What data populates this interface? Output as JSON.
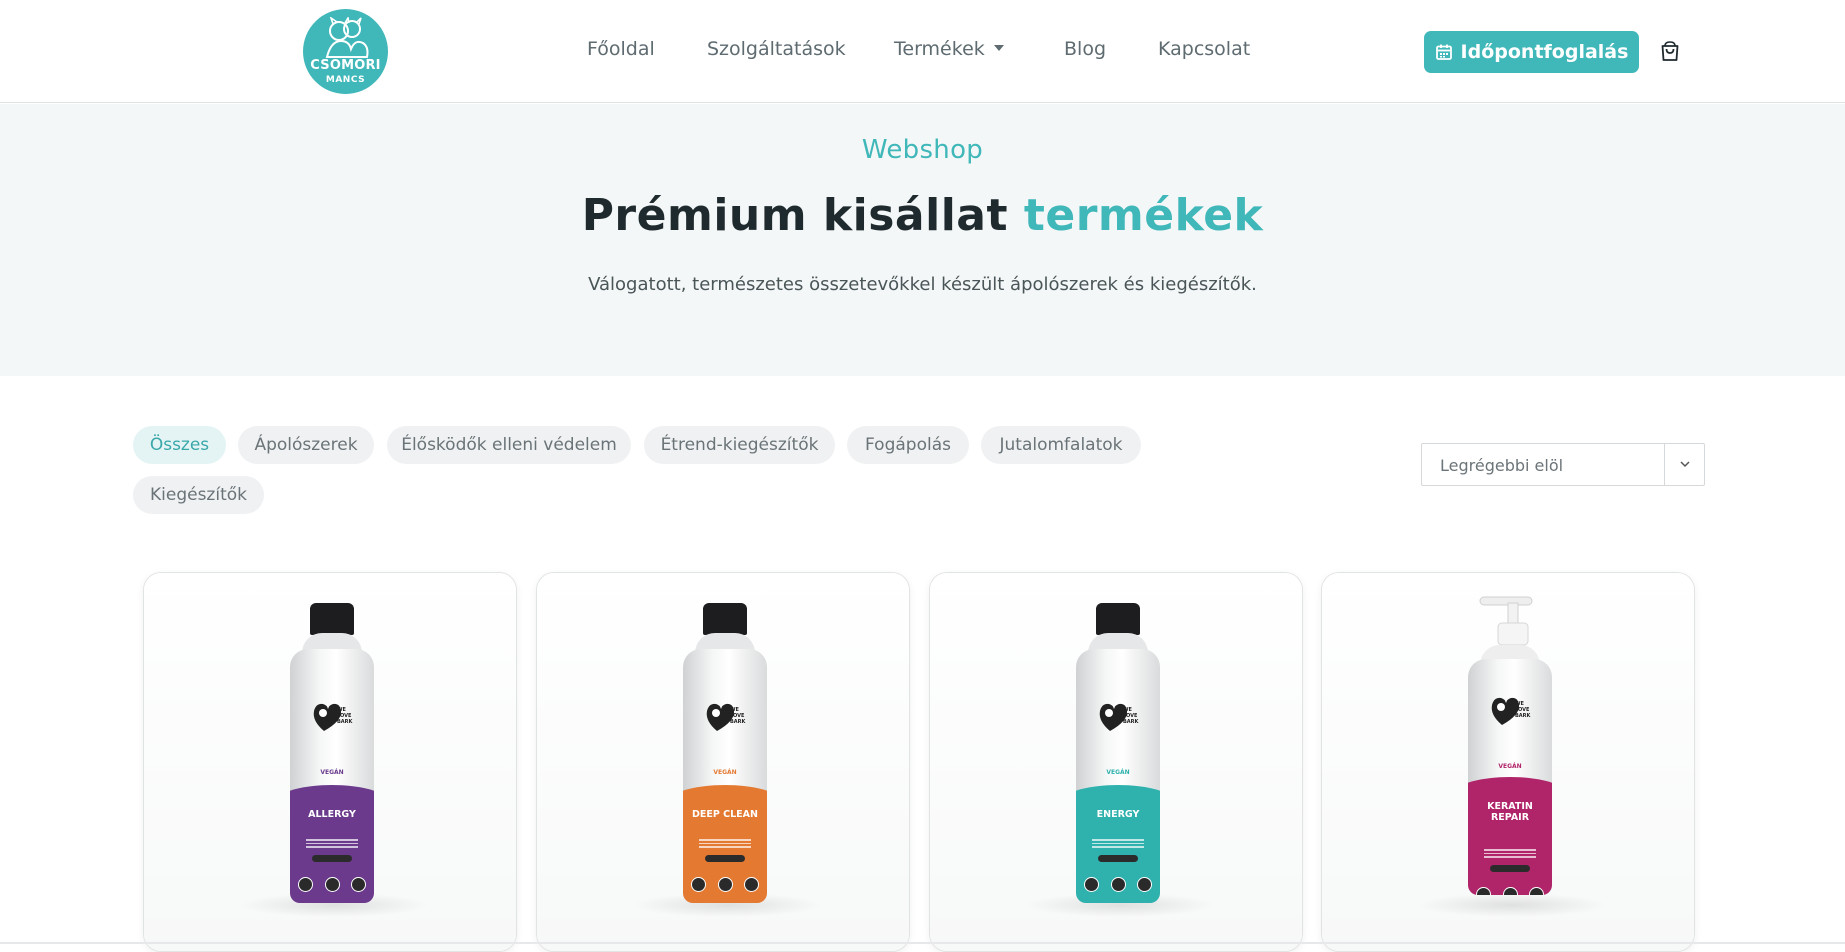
{
  "header": {
    "logo": {
      "name": "CSÖMÖRI",
      "sub": "MANCS"
    },
    "nav": [
      {
        "label": "Főoldal"
      },
      {
        "label": "Szolgáltatások"
      },
      {
        "label": "Termékek"
      },
      {
        "label": "Blog"
      },
      {
        "label": "Kapcsolat"
      }
    ],
    "book_button": "Időpontfoglalás"
  },
  "hero": {
    "kicker": "Webshop",
    "title_main": "Prémium kisállat",
    "title_accent": "termékek",
    "subtitle": "Válogatott, természetes összetevőkkel készült ápolószerek és kiegészítők."
  },
  "filters": [
    {
      "label": "Összes",
      "active": true
    },
    {
      "label": "Ápolószerek",
      "active": false
    },
    {
      "label": "Élősködők elleni védelem",
      "active": false
    },
    {
      "label": "Étrend-kiegészítők",
      "active": false
    },
    {
      "label": "Fogápolás",
      "active": false
    },
    {
      "label": "Jutalomfalatok",
      "active": false
    },
    {
      "label": "Kiegészítők",
      "active": false
    }
  ],
  "sort": {
    "value": "Legrégebbi elöl"
  },
  "products": [
    {
      "name_line1": "ALLERGY",
      "name_line2": "",
      "color": "#6b3a8c",
      "accent": "#6b3a8c",
      "type": "bottle"
    },
    {
      "name_line1": "DEEP CLEAN",
      "name_line2": "",
      "color": "#e47a32",
      "accent": "#e47a32",
      "type": "bottle"
    },
    {
      "name_line1": "ENERGY",
      "name_line2": "",
      "color": "#2fb2ad",
      "accent": "#2fb2ad",
      "type": "bottle"
    },
    {
      "name_line1": "KERATIN",
      "name_line2": "REPAIR",
      "color": "#b0256a",
      "accent": "#b0256a",
      "type": "pump"
    }
  ],
  "brand_label": "VEGÁN",
  "colors": {
    "teal": "#40b7b9",
    "dark": "#1f2a2e",
    "hero_bg": "#f4f7f7"
  }
}
